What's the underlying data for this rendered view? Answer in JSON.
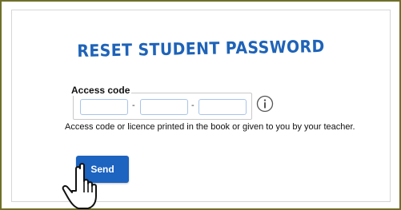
{
  "title": "RESET STUDENT PASSWORD",
  "access_code": {
    "label": "Access code",
    "separator": "-",
    "values": [
      "",
      "",
      ""
    ]
  },
  "help_text": "Access code or licence printed in the book or given to you by your teacher.",
  "send_label": "Send",
  "icons": {
    "info": "info-circle-icon",
    "cursor": "hand-pointer-icon"
  },
  "colors": {
    "title": "#1e63b8",
    "button": "#1d63c0",
    "frame": "#6f6f2a"
  }
}
